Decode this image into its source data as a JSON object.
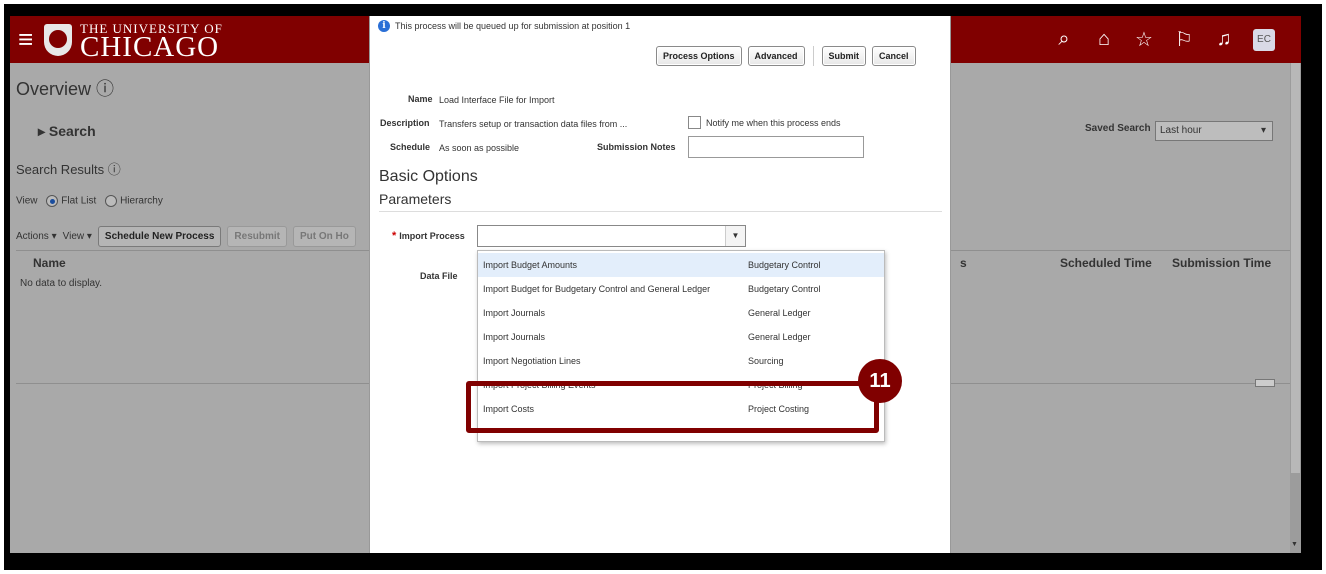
{
  "header": {
    "brand_top": "THE UNIVERSITY OF",
    "brand_main": "CHICAGO",
    "icons": [
      "search-icon",
      "home-icon",
      "star-icon",
      "flag-icon",
      "bell-icon"
    ],
    "avatar": "EC",
    "bg_color": "#800000"
  },
  "page": {
    "title": "Overview",
    "search_heading": "Search",
    "results_heading": "Search Results",
    "view_label": "View",
    "view_options": [
      "Flat List",
      "Hierarchy"
    ],
    "toolbar": {
      "actions": "Actions",
      "view": "View",
      "schedule": "Schedule New Process",
      "resubmit": "Resubmit",
      "put_on_hold": "Put On Ho"
    },
    "columns": {
      "name": "Name",
      "scheduled": "Scheduled Time",
      "submission": "Submission Time",
      "partial": "s"
    },
    "no_data": "No data to display.",
    "saved_search_label": "Saved Search",
    "saved_search_value": "Last hour"
  },
  "dialog": {
    "info": "This process will be queued up for submission at position 1",
    "buttons": {
      "process_options": "Process Options",
      "advanced": "Advanced",
      "submit": "Submit",
      "cancel": "Cancel"
    },
    "name_label": "Name",
    "name_value": "Load Interface File for Import",
    "description_label": "Description",
    "description_value": "Transfers setup or transaction data files from ...",
    "notify_label": "Notify me when this process ends",
    "schedule_label": "Schedule",
    "schedule_value": "As soon as possible",
    "notes_label": "Submission Notes",
    "basic_options": "Basic Options",
    "parameters": "Parameters",
    "import_process_label": "Import Process",
    "required_mark": "*",
    "data_file_label": "Data File",
    "options": [
      {
        "name": "Import Budget Amounts",
        "category": "Budgetary Control"
      },
      {
        "name": "Import Budget for Budgetary Control and General Ledger",
        "category": "Budgetary Control"
      },
      {
        "name": "Import Journals",
        "category": "General Ledger"
      },
      {
        "name": "Import Journals",
        "category": "General Ledger"
      },
      {
        "name": "Import Negotiation Lines",
        "category": "Sourcing"
      },
      {
        "name": "Import Project Billing Events",
        "category": "Project Billing"
      },
      {
        "name": "Import Costs",
        "category": "Project Costing"
      }
    ]
  },
  "callout": {
    "number": "11",
    "color": "#800000"
  }
}
